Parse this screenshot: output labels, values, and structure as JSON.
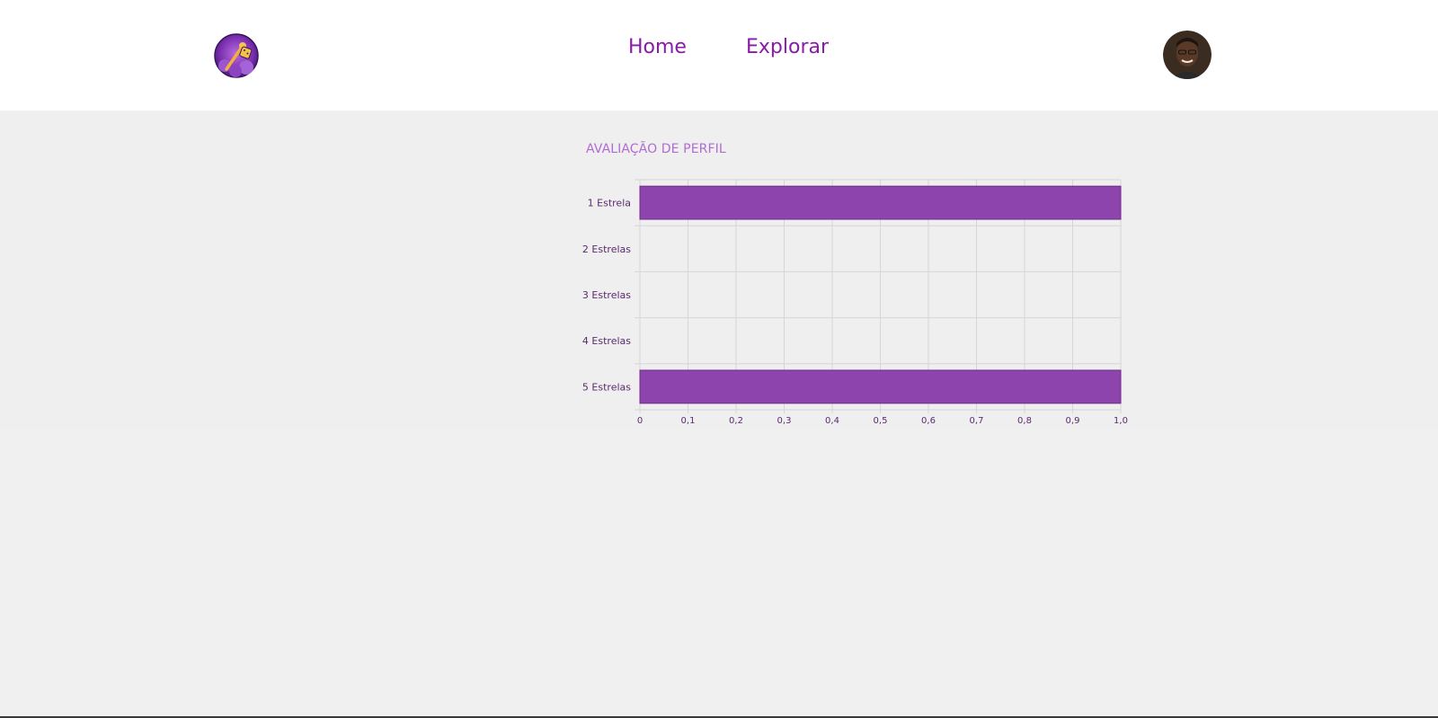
{
  "header": {
    "nav": [
      {
        "label": "Home"
      },
      {
        "label": "Explorar"
      }
    ],
    "logo_icon": "game-dice-wand-logo",
    "avatar_icon": "user-avatar"
  },
  "colors": {
    "accent": "#8a1aaa",
    "title": "#b06cd3",
    "bar": "#8e44ad",
    "bar_border": "#6c2d88",
    "grid": "#d6d6d6",
    "label": "#5b2a6e",
    "header_bg": "#ffffff",
    "page_bg": "#f0f0f0"
  },
  "chart_data": {
    "type": "bar",
    "orientation": "horizontal",
    "title": "AVALIAÇÃO DE PERFIL",
    "categories": [
      "1 Estrela",
      "2 Estrelas",
      "3 Estrelas",
      "4 Estrelas",
      "5 Estrelas"
    ],
    "values": [
      1,
      0,
      0,
      0,
      1
    ],
    "xlim": [
      0,
      1
    ],
    "x_ticks": [
      "0",
      "0,1",
      "0,2",
      "0,3",
      "0,4",
      "0,5",
      "0,6",
      "0,7",
      "0,8",
      "0,9",
      "1,0"
    ],
    "grid": true,
    "legend": "none"
  }
}
